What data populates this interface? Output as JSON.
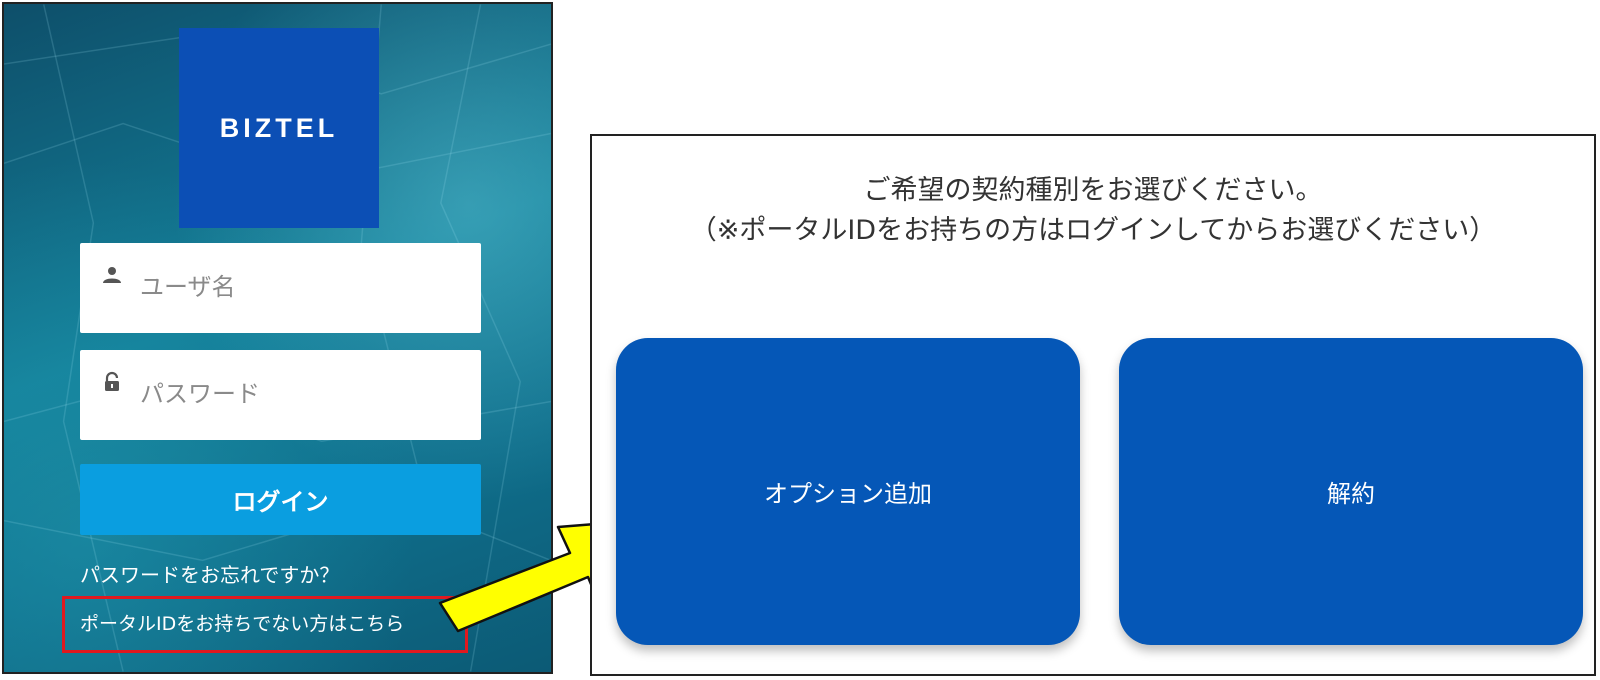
{
  "login": {
    "logo_text": "BIZTEL",
    "username_placeholder": "ユーザ名",
    "password_placeholder": "パスワード",
    "login_button": "ログイン",
    "forgot_password_link": "パスワードをお忘れですか？",
    "no_portal_id_link": "ポータルIDをお持ちでない方はこちら"
  },
  "selection": {
    "prompt_line1": "ご希望の契約種別をお選びください。",
    "prompt_line2": "（※ポータルIDをお持ちの方はログインしてからお選びください）",
    "options": [
      {
        "label": "オプション追加"
      },
      {
        "label": "解約"
      }
    ]
  },
  "colors": {
    "logo_bg": "#0c4fb5",
    "login_button": "#0a9ee0",
    "option_card": "#0557b7",
    "highlight_box": "#e0191f",
    "arrow_fill": "#ffff00"
  }
}
